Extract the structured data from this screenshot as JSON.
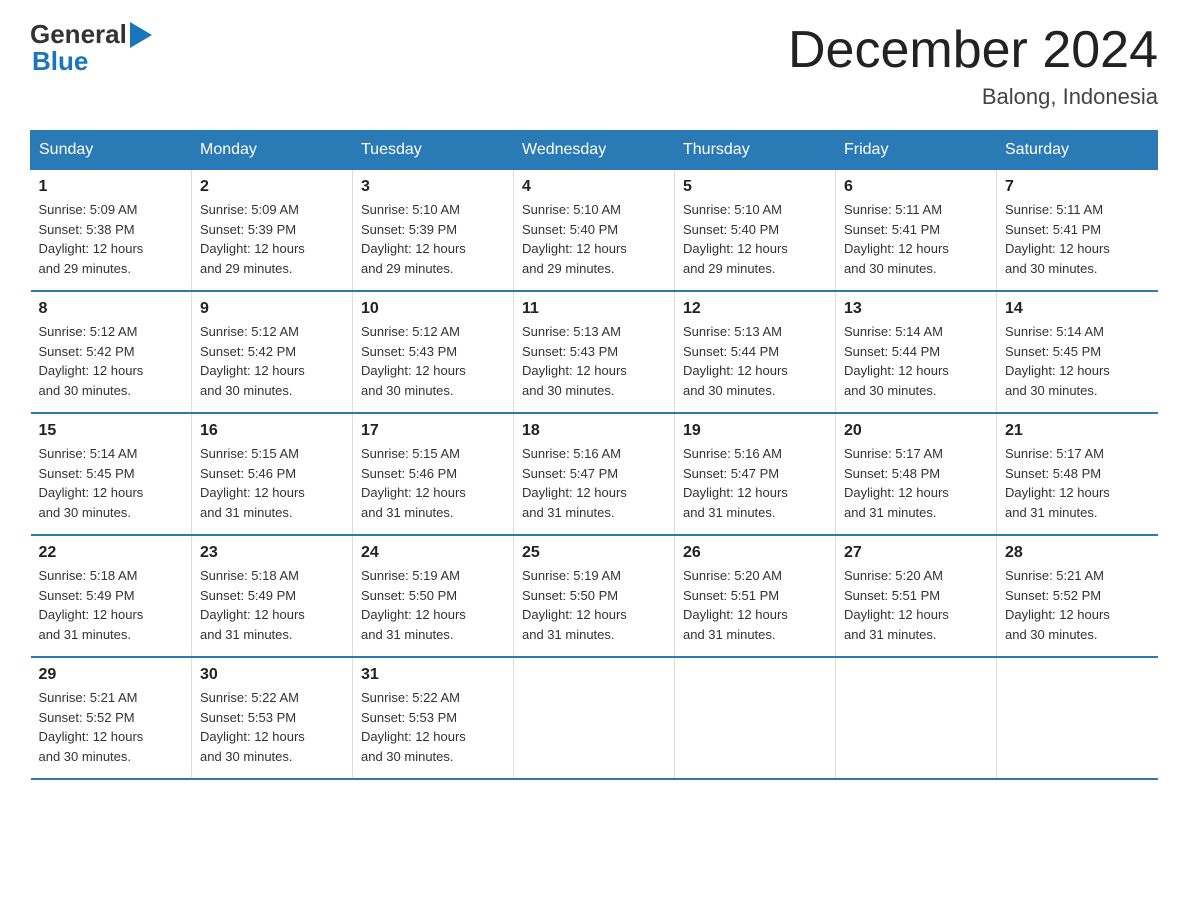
{
  "logo": {
    "general": "General",
    "blue": "Blue"
  },
  "title": "December 2024",
  "subtitle": "Balong, Indonesia",
  "days_header": [
    "Sunday",
    "Monday",
    "Tuesday",
    "Wednesday",
    "Thursday",
    "Friday",
    "Saturday"
  ],
  "weeks": [
    [
      {
        "day": "1",
        "info": "Sunrise: 5:09 AM\nSunset: 5:38 PM\nDaylight: 12 hours\nand 29 minutes."
      },
      {
        "day": "2",
        "info": "Sunrise: 5:09 AM\nSunset: 5:39 PM\nDaylight: 12 hours\nand 29 minutes."
      },
      {
        "day": "3",
        "info": "Sunrise: 5:10 AM\nSunset: 5:39 PM\nDaylight: 12 hours\nand 29 minutes."
      },
      {
        "day": "4",
        "info": "Sunrise: 5:10 AM\nSunset: 5:40 PM\nDaylight: 12 hours\nand 29 minutes."
      },
      {
        "day": "5",
        "info": "Sunrise: 5:10 AM\nSunset: 5:40 PM\nDaylight: 12 hours\nand 29 minutes."
      },
      {
        "day": "6",
        "info": "Sunrise: 5:11 AM\nSunset: 5:41 PM\nDaylight: 12 hours\nand 30 minutes."
      },
      {
        "day": "7",
        "info": "Sunrise: 5:11 AM\nSunset: 5:41 PM\nDaylight: 12 hours\nand 30 minutes."
      }
    ],
    [
      {
        "day": "8",
        "info": "Sunrise: 5:12 AM\nSunset: 5:42 PM\nDaylight: 12 hours\nand 30 minutes."
      },
      {
        "day": "9",
        "info": "Sunrise: 5:12 AM\nSunset: 5:42 PM\nDaylight: 12 hours\nand 30 minutes."
      },
      {
        "day": "10",
        "info": "Sunrise: 5:12 AM\nSunset: 5:43 PM\nDaylight: 12 hours\nand 30 minutes."
      },
      {
        "day": "11",
        "info": "Sunrise: 5:13 AM\nSunset: 5:43 PM\nDaylight: 12 hours\nand 30 minutes."
      },
      {
        "day": "12",
        "info": "Sunrise: 5:13 AM\nSunset: 5:44 PM\nDaylight: 12 hours\nand 30 minutes."
      },
      {
        "day": "13",
        "info": "Sunrise: 5:14 AM\nSunset: 5:44 PM\nDaylight: 12 hours\nand 30 minutes."
      },
      {
        "day": "14",
        "info": "Sunrise: 5:14 AM\nSunset: 5:45 PM\nDaylight: 12 hours\nand 30 minutes."
      }
    ],
    [
      {
        "day": "15",
        "info": "Sunrise: 5:14 AM\nSunset: 5:45 PM\nDaylight: 12 hours\nand 30 minutes."
      },
      {
        "day": "16",
        "info": "Sunrise: 5:15 AM\nSunset: 5:46 PM\nDaylight: 12 hours\nand 31 minutes."
      },
      {
        "day": "17",
        "info": "Sunrise: 5:15 AM\nSunset: 5:46 PM\nDaylight: 12 hours\nand 31 minutes."
      },
      {
        "day": "18",
        "info": "Sunrise: 5:16 AM\nSunset: 5:47 PM\nDaylight: 12 hours\nand 31 minutes."
      },
      {
        "day": "19",
        "info": "Sunrise: 5:16 AM\nSunset: 5:47 PM\nDaylight: 12 hours\nand 31 minutes."
      },
      {
        "day": "20",
        "info": "Sunrise: 5:17 AM\nSunset: 5:48 PM\nDaylight: 12 hours\nand 31 minutes."
      },
      {
        "day": "21",
        "info": "Sunrise: 5:17 AM\nSunset: 5:48 PM\nDaylight: 12 hours\nand 31 minutes."
      }
    ],
    [
      {
        "day": "22",
        "info": "Sunrise: 5:18 AM\nSunset: 5:49 PM\nDaylight: 12 hours\nand 31 minutes."
      },
      {
        "day": "23",
        "info": "Sunrise: 5:18 AM\nSunset: 5:49 PM\nDaylight: 12 hours\nand 31 minutes."
      },
      {
        "day": "24",
        "info": "Sunrise: 5:19 AM\nSunset: 5:50 PM\nDaylight: 12 hours\nand 31 minutes."
      },
      {
        "day": "25",
        "info": "Sunrise: 5:19 AM\nSunset: 5:50 PM\nDaylight: 12 hours\nand 31 minutes."
      },
      {
        "day": "26",
        "info": "Sunrise: 5:20 AM\nSunset: 5:51 PM\nDaylight: 12 hours\nand 31 minutes."
      },
      {
        "day": "27",
        "info": "Sunrise: 5:20 AM\nSunset: 5:51 PM\nDaylight: 12 hours\nand 31 minutes."
      },
      {
        "day": "28",
        "info": "Sunrise: 5:21 AM\nSunset: 5:52 PM\nDaylight: 12 hours\nand 30 minutes."
      }
    ],
    [
      {
        "day": "29",
        "info": "Sunrise: 5:21 AM\nSunset: 5:52 PM\nDaylight: 12 hours\nand 30 minutes."
      },
      {
        "day": "30",
        "info": "Sunrise: 5:22 AM\nSunset: 5:53 PM\nDaylight: 12 hours\nand 30 minutes."
      },
      {
        "day": "31",
        "info": "Sunrise: 5:22 AM\nSunset: 5:53 PM\nDaylight: 12 hours\nand 30 minutes."
      },
      {
        "day": "",
        "info": ""
      },
      {
        "day": "",
        "info": ""
      },
      {
        "day": "",
        "info": ""
      },
      {
        "day": "",
        "info": ""
      }
    ]
  ]
}
